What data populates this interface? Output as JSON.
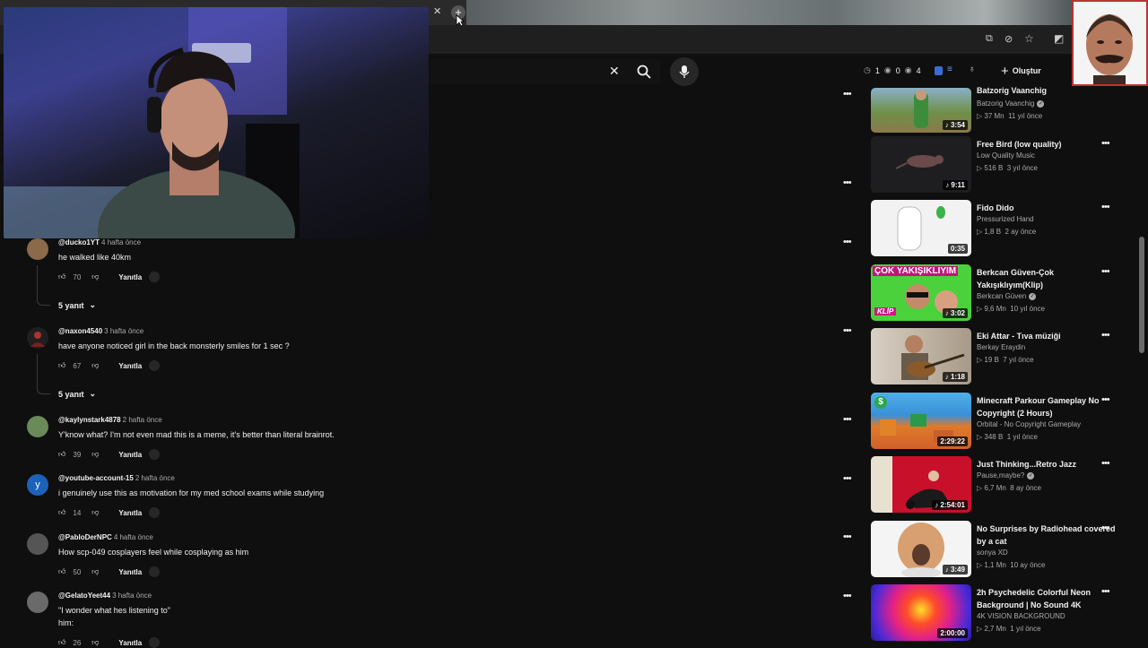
{
  "browser": {
    "tab_title_fragment": "Y",
    "new_tab_symbol": "+"
  },
  "header": {
    "create_label": "Oluştur",
    "counters": [
      "1",
      "0",
      "4"
    ]
  },
  "comments": [
    {
      "author": "@ducko1YT",
      "time": "4 hafta önce",
      "text": "he walked like 40km",
      "likes": "70",
      "reply": "Yanıtla",
      "replies": "5 yanıt"
    },
    {
      "author": "@naxon4540",
      "time": "3 hafta önce",
      "text": "have anyone noticed girl in the back monsterly smiles for 1 sec ?",
      "likes": "67",
      "reply": "Yanıtla",
      "replies": "5 yanıt"
    },
    {
      "author": "@kaylynstark4878",
      "time": "2 hafta önce",
      "text": "Y'know what? I'm not even mad this is a meme, it's better than literal brainrot.",
      "likes": "39",
      "reply": "Yanıtla"
    },
    {
      "author": "@youtube-account-15",
      "time": "2 hafta önce",
      "text": "i genuinely use this as motivation for my med school exams while studying",
      "likes": "14",
      "reply": "Yanıtla",
      "avatar_letter": "y"
    },
    {
      "author": "@PabloDerNPC",
      "time": "4 hafta önce",
      "text": "How scp-049 cosplayers feel while cosplaying as him",
      "likes": "50",
      "reply": "Yanıtla"
    },
    {
      "author": "@GelatoYeet44",
      "time": "3 hafta önce",
      "text": "\"I wonder what hes listening to\"\nhim:",
      "likes": "26",
      "reply": "Yanıtla"
    }
  ],
  "sidebar": [
    {
      "title": "Batzorig Vaanchig",
      "channel": "Batzorig Vaanchig",
      "verified": true,
      "views": "37 Mn",
      "age": "11 yıl önce",
      "duration": "3:54",
      "music": true
    },
    {
      "title": "Free Bird (low quality)",
      "channel": "Low Quality Music",
      "verified": false,
      "views": "516 B",
      "age": "3 yıl önce",
      "duration": "9:11",
      "music": true
    },
    {
      "title": "Fido Dido",
      "channel": "Pressurized Hand",
      "verified": false,
      "views": "1,8 B",
      "age": "2 ay önce",
      "duration": "0:35",
      "music": false
    },
    {
      "title": "Berkcan Güven-Çok Yakışıklıyım(Klip)",
      "channel": "Berkcan Güven",
      "verified": true,
      "views": "9,6 Mn",
      "age": "10 yıl önce",
      "duration": "3:02",
      "music": true,
      "thumb_text": "ÇOK YAKIŞIKLIYIM",
      "thumb_badge": "KLİP"
    },
    {
      "title": "Eki Attar - Tıva müziği",
      "channel": "Berkay Eraydin",
      "verified": false,
      "views": "19 B",
      "age": "7 yıl önce",
      "duration": "1:18",
      "music": true
    },
    {
      "title": "Minecraft Parkour Gameplay No Copyright (2 Hours)",
      "channel": "Orbital - No Copyright Gameplay",
      "verified": false,
      "views": "348 B",
      "age": "1 yıl önce",
      "duration": "2:29:22",
      "music": false
    },
    {
      "title": "Just Thinking...Retro Jazz",
      "channel": "Pause,maybe?",
      "verified": true,
      "views": "6,7 Mn",
      "age": "8 ay önce",
      "duration": "2:54:01",
      "music": true
    },
    {
      "title": "No Surprises by Radiohead covered by a cat",
      "channel": "sonya XD",
      "verified": false,
      "views": "1,1 Mn",
      "age": "10 ay önce",
      "duration": "3:49",
      "music": true
    },
    {
      "title": "2h Psychedelic Colorful Neon Background | No Sound 4K",
      "channel": "4K VISION BACKGROUND",
      "verified": false,
      "views": "2,7 Mn",
      "age": "1 yıl önce",
      "duration": "2:00:00",
      "music": false
    }
  ],
  "colors": {
    "background": "#0f0f0f",
    "text": "#f1f1f1",
    "secondary_text": "#aaaaaa"
  }
}
